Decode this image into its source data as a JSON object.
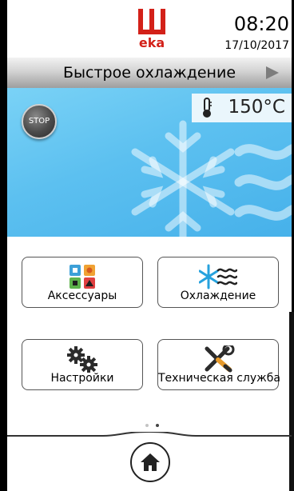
{
  "brand": {
    "name": "eka",
    "color": "#d32119"
  },
  "status": {
    "time": "08:20",
    "date": "17/10/2017"
  },
  "title_bar": {
    "title": "Быстрое охлаждение",
    "next_icon": "play-icon"
  },
  "hero": {
    "stop_label": "STOP",
    "temperature": "150°C",
    "thermometer_icon": "thermometer-icon",
    "background_icon": "snowflake-icon",
    "colors": {
      "top": "#7ad2f6",
      "bottom": "#46b1ea"
    }
  },
  "menu": {
    "tiles": [
      {
        "label": "Аксессуары",
        "icon": "accessories-icon"
      },
      {
        "label": "Охлаждение",
        "icon": "cooling-icon"
      },
      {
        "label": "Настройки",
        "icon": "settings-gears-icon"
      },
      {
        "label": "Техническая служба",
        "icon": "service-tools-icon"
      }
    ]
  },
  "pager": {
    "total": 2,
    "active": 2
  },
  "bottom": {
    "home_icon": "home-icon"
  }
}
